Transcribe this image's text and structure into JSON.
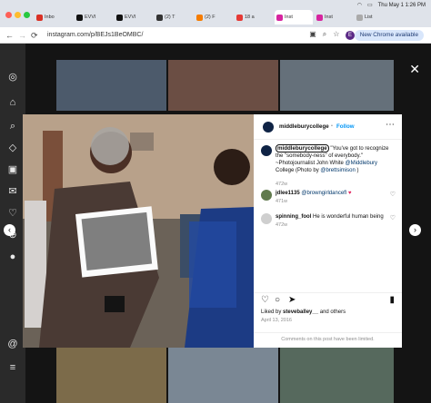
{
  "browser": {
    "tabs": [
      {
        "label": "Inbo",
        "color": "#d93025"
      },
      {
        "label": "EVVI",
        "color": "#111111"
      },
      {
        "label": "EVVI",
        "color": "#111111"
      },
      {
        "label": "(2) T",
        "color": "#333333"
      },
      {
        "label": "(2) F",
        "color": "#f57c00"
      },
      {
        "label": "18 a",
        "color": "#e53935"
      },
      {
        "label": "Inst",
        "color": "#d6249f"
      },
      {
        "label": "Inst",
        "color": "#d6249f"
      },
      {
        "label": "List",
        "color": "#999999"
      }
    ],
    "status_time": "Thu May 1  1:26 PM",
    "url": "instagram.com/p/BEJs1BeOMBC/",
    "new_chrome_label": "New Chrome available",
    "profile_initial": "E"
  },
  "post": {
    "username": "middleburycollege",
    "follow_label": "Follow",
    "caption_user": "middleburycollege",
    "caption_text": " \"You've got to recognize the \"somebody-ness\" of everybody.\" ~Photojournalist John White ",
    "caption_mention_1": "@Middlebury",
    "caption_text_2": " College (Photo by ",
    "caption_mention_2": "@brettsimison",
    "caption_text_3": " )",
    "caption_age": "472w",
    "comments": [
      {
        "user": "jdlee1135",
        "mention": "@browngirldancefl",
        "emoji": "♥",
        "age": "471w"
      },
      {
        "user": "spinning_fool",
        "text": "He is wonderful human being",
        "age": "472w"
      }
    ],
    "liked_by_prefix": "Liked by",
    "liked_by_user": "steveballey__",
    "liked_by_suffix": "and others",
    "post_date": "April 13, 2016",
    "comments_limited": "Comments on this post have been limited."
  }
}
